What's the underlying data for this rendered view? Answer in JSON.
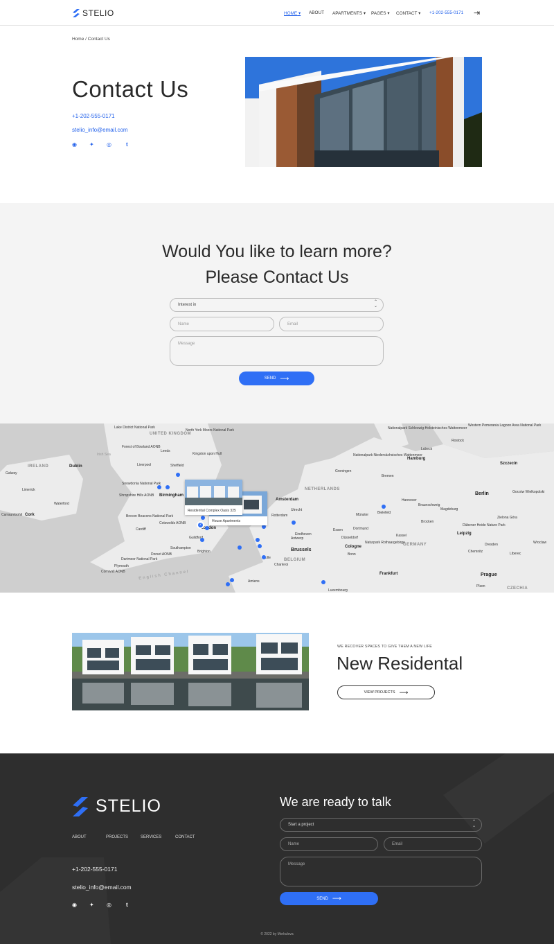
{
  "header": {
    "logo_text": "STELIO",
    "nav": [
      {
        "label": "HOME",
        "caret": true
      },
      {
        "label": "ABOUT",
        "caret": false
      },
      {
        "label": "APARTMENTS",
        "caret": true
      },
      {
        "label": "PAGES",
        "caret": true
      },
      {
        "label": "CONTACT",
        "caret": true
      }
    ],
    "phone": "+1-202-555-0171",
    "login_icon": "login-arrow-icon"
  },
  "breadcrumb": "Home / Contact Us",
  "hero": {
    "title": "Contact Us",
    "phone": "+1-202-555-0171",
    "email": "stelio_info@email.com",
    "social_icons": [
      "facebook-icon",
      "twitter-icon",
      "instagram-icon",
      "tumblr-icon"
    ]
  },
  "contact": {
    "title_line1": "Would You like to learn more?",
    "title_line2": "Please Contact Us",
    "interest_placeholder": "Interest in",
    "name_placeholder": "Name",
    "email_placeholder": "Email",
    "message_placeholder": "Message",
    "send_label": "SEND"
  },
  "map": {
    "cities": [
      "Dublin",
      "Liverpool",
      "Sheffield",
      "Leeds",
      "Birmingham",
      "London",
      "Cardiff",
      "Southampton",
      "Brighton",
      "Plymouth",
      "Amsterdam",
      "Rotterdam",
      "Utrecht",
      "Antwerp",
      "Brussels",
      "Lille",
      "Charleroi",
      "Amiens",
      "Luxembourg",
      "Cologne",
      "Bonn",
      "Essen",
      "Dortmund",
      "Düsseldorf",
      "Münster",
      "Bielefeld",
      "Hannover",
      "Braunschweig",
      "Magdeburg",
      "Hamburg",
      "Bremen",
      "Lubeck",
      "Rostock",
      "Szczecin",
      "Berlin",
      "Leipzig",
      "Dresden",
      "Chemnitz",
      "Prague",
      "Plzen",
      "Frankfurt",
      "Kassel",
      "Eindhoven",
      "Groningen",
      "Kingston upon Hull",
      "Galway",
      "Limerick",
      "Waterford",
      "Cork",
      "Guildford",
      "Zielona Góra",
      "Liberec",
      "Wroclaw",
      "Gorzów Wielkopolski"
    ],
    "regions": [
      "UNITED KINGDOM",
      "IRELAND",
      "NETHERLANDS",
      "BELGIUM",
      "GERMANY",
      "CZECHIA"
    ],
    "water": [
      "English Channel",
      "Irish Sea"
    ],
    "parks": [
      "Lake District National Park",
      "North York Moors National Park",
      "Forest of Bowland AONB",
      "Snowdonia National Park",
      "Shropshire Hills AONB",
      "Brecon Beacons National Park",
      "Cotswolds AONB",
      "Dorset AONB",
      "Dartmoor National Park",
      "Cornwall AONB",
      "Nationalpark Schleswig-Holsteinisches Wattenmeer",
      "Nationalpark Niedersächsisches Wattenmeer",
      "Naturpark Rothaargebirge",
      "Dübener Heide Nature Park",
      "Western Pomerania Lagoon Area National Park"
    ],
    "card_main": "Residential Complex Oasis 325",
    "card_second": "House Apartments",
    "cluster_count": "2"
  },
  "residental": {
    "kicker": "WE RECOVER SPACES TO GIVE THEM A NEW LIFE",
    "title": "New Residental",
    "button_label": "VIEW PROJECTS"
  },
  "footer": {
    "logo_text": "STELIO",
    "nav": [
      "ABOUT",
      "PROJECTS",
      "SERVICES",
      "CONTACT"
    ],
    "phone": "+1-202-555-0171",
    "email": "stelio_info@email.com",
    "title": "We are ready to talk",
    "project_placeholder": "Start a project",
    "name_placeholder": "Name",
    "email_placeholder": "Email",
    "message_placeholder": "Message",
    "send_label": "SEND",
    "copyright": "© 2022 by Morkulova"
  },
  "colors": {
    "accent": "#2f6ff5",
    "footer_bg": "#2e2e2e",
    "section_bg": "#f4f4f4"
  }
}
